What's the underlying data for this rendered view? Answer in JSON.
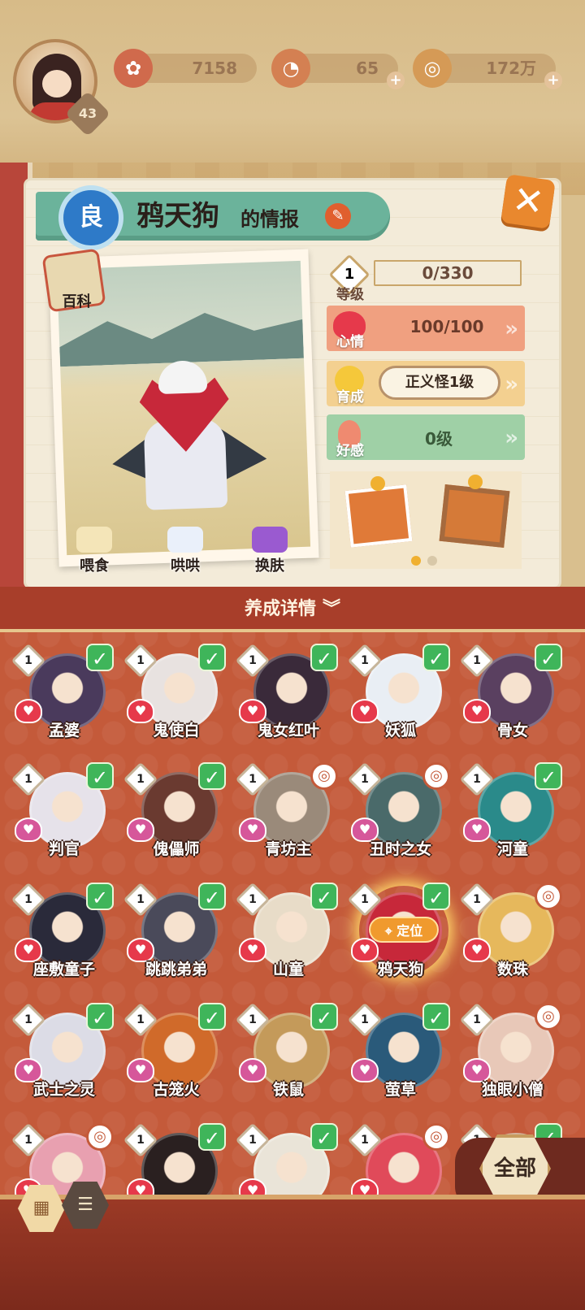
{
  "resources": {
    "player_level": "43",
    "coins": "7158",
    "jade": "65",
    "gold": "172万"
  },
  "info_panel": {
    "grade": "良",
    "name": "鸦天狗",
    "title_suffix": "的情报",
    "encyclopedia_label": "百科",
    "actions": [
      "喂食",
      "哄哄",
      "换肤"
    ],
    "level_value": "1",
    "level_label": "等级",
    "exp": "0/330",
    "mood_label": "心情",
    "mood_value": "100/100",
    "growth_label": "育成",
    "growth_value": "正义怪1级",
    "favor_label": "好感",
    "favor_value": "0级"
  },
  "list": {
    "title": "养成详情",
    "all_label": "全部",
    "locate_label": "定位",
    "rows": [
      [
        {
          "name": "孟婆",
          "level": "1",
          "status": "check",
          "color": "#4a3a5c"
        },
        {
          "name": "鬼使白",
          "level": "1",
          "status": "check",
          "color": "#e8e2e0"
        },
        {
          "name": "鬼女红叶",
          "level": "1",
          "status": "check",
          "color": "#3a2a3a"
        },
        {
          "name": "妖狐",
          "level": "1",
          "status": "check",
          "color": "#e9eef4"
        },
        {
          "name": "骨女",
          "level": "1",
          "status": "check",
          "color": "#5a4060"
        }
      ],
      [
        {
          "name": "判官",
          "level": "1",
          "status": "check",
          "color": "#e6e2ea"
        },
        {
          "name": "傀儡师",
          "level": "1",
          "status": "check",
          "color": "#6a3a30"
        },
        {
          "name": "青坊主",
          "level": "1",
          "status": "alt",
          "color": "#9a8a7a"
        },
        {
          "name": "丑时之女",
          "level": "1",
          "status": "alt",
          "color": "#4a6a6a"
        },
        {
          "name": "河童",
          "level": "1",
          "status": "check",
          "color": "#2a8a8a"
        }
      ],
      [
        {
          "name": "座敷童子",
          "level": "1",
          "status": "check",
          "color": "#2a2a3a"
        },
        {
          "name": "跳跳弟弟",
          "level": "1",
          "status": "check",
          "color": "#4a4a5a"
        },
        {
          "name": "山童",
          "level": "1",
          "status": "check",
          "color": "#e8dcc8"
        },
        {
          "name": "鸦天狗",
          "level": "1",
          "status": "check",
          "color": "#c7283a",
          "selected": true
        },
        {
          "name": "数珠",
          "level": "1",
          "status": "alt",
          "color": "#e6b85c"
        }
      ],
      [
        {
          "name": "武士之灵",
          "level": "1",
          "status": "check",
          "color": "#dcdce6"
        },
        {
          "name": "古笼火",
          "level": "1",
          "status": "check",
          "color": "#d06a2a"
        },
        {
          "name": "铁鼠",
          "level": "1",
          "status": "check",
          "color": "#c49a5a"
        },
        {
          "name": "萤草",
          "level": "1",
          "status": "check",
          "color": "#2a5a7a"
        },
        {
          "name": "独眼小僧",
          "level": "1",
          "status": "alt",
          "color": "#e8c8b8"
        }
      ],
      [
        {
          "name": "",
          "level": "1",
          "status": "alt",
          "color": "#e8a0b0"
        },
        {
          "name": "",
          "level": "1",
          "status": "check",
          "color": "#2a2020"
        },
        {
          "name": "",
          "level": "1",
          "status": "check",
          "color": "#eae4d8"
        },
        {
          "name": "",
          "level": "1",
          "status": "alt",
          "color": "#e04a5a"
        },
        {
          "name": "",
          "level": "1",
          "status": "check",
          "color": "#c49a7a"
        }
      ]
    ]
  },
  "colors": {
    "accent": "#c45a3a",
    "check": "#3fb55a",
    "mood": "#f0a080",
    "growth": "#f3d090",
    "favor": "#9fd0a6"
  }
}
